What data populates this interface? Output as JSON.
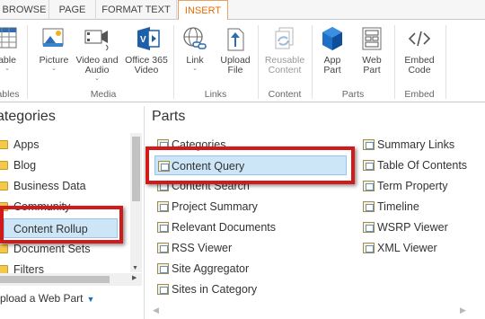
{
  "tabs": [
    {
      "label": "BROWSE"
    },
    {
      "label": "PAGE"
    },
    {
      "label": "FORMAT TEXT"
    },
    {
      "label": "INSERT",
      "active": true
    }
  ],
  "ribbon": {
    "buttons": {
      "table": {
        "line1": "able",
        "icon": "table-icon"
      },
      "picture": {
        "line1": "Picture",
        "icon": "picture-icon"
      },
      "video_audio": {
        "line1": "Video and",
        "line2": "Audio",
        "icon": "video-audio-icon"
      },
      "office365": {
        "line1": "Office 365",
        "line2": "Video",
        "icon": "office365-video-icon"
      },
      "link": {
        "line1": "Link",
        "icon": "link-icon"
      },
      "upload_file": {
        "line1": "Upload",
        "line2": "File",
        "icon": "upload-file-icon"
      },
      "reusable": {
        "line1": "Reusable",
        "line2": "Content",
        "icon": "reusable-content-icon"
      },
      "app_part": {
        "line1": "App",
        "line2": "Part",
        "icon": "app-part-icon"
      },
      "web_part": {
        "line1": "Web",
        "line2": "Part",
        "icon": "web-part-icon"
      },
      "embed": {
        "line1": "Embed",
        "line2": "Code",
        "icon": "embed-code-icon"
      }
    },
    "groups": {
      "tables": "ables",
      "media": "Media",
      "links": "Links",
      "content": "Content",
      "parts": "Parts",
      "embed": "Embed"
    },
    "caret": "⌄"
  },
  "categories": {
    "title": "ategories",
    "items": [
      "Apps",
      "Blog",
      "Business Data",
      "Community",
      "Content Rollup",
      "Document Sets",
      "Filters"
    ],
    "selected": "Content Rollup"
  },
  "upload": {
    "label": "pload a Web Part",
    "caret": "▼"
  },
  "parts": {
    "title": "Parts",
    "col1": [
      "Categories",
      "Content Query",
      "Content Search",
      "Project Summary",
      "Relevant Documents",
      "RSS Viewer",
      "Site Aggregator",
      "Sites in Category"
    ],
    "col2": [
      "Summary Links",
      "Table Of Contents",
      "Term Property",
      "Timeline",
      "WSRP Viewer",
      "XML Viewer"
    ],
    "selected": "Content Query"
  },
  "scroll": {
    "up": "▲",
    "down": "▼",
    "left": "◀",
    "right": "▶"
  },
  "colors": {
    "accent": "#e86c00",
    "highlight_box": "#d11a1a",
    "selection": "#cde6f7",
    "office_blue": "#1f5fa8"
  }
}
